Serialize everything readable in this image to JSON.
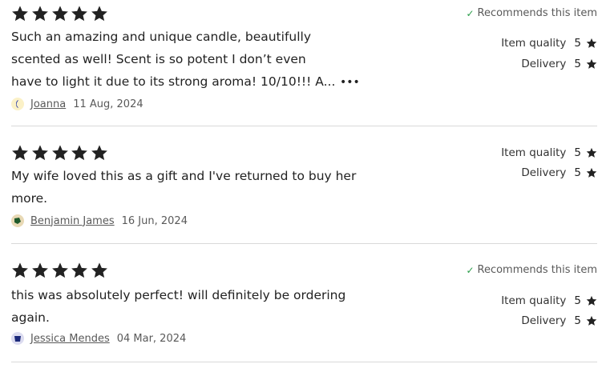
{
  "labels": {
    "recommends": "Recommends this item",
    "item_quality": "Item quality",
    "delivery": "Delivery"
  },
  "reviews": [
    {
      "rating": 5,
      "recommends": true,
      "text_lines": [
        "Such an amazing and unique candle, beautifully",
        "scented as well! Scent is so potent I don’t even",
        "have to light it due to its strong aroma! 10/10!!! A..."
      ],
      "more": "•••",
      "item_quality": "5",
      "delivery": "5",
      "author": "Joanna",
      "date": "11 Aug, 2024"
    },
    {
      "rating": 5,
      "recommends": false,
      "text_lines": [
        "My wife loved this as a gift and I've returned to buy her",
        "more."
      ],
      "item_quality": "5",
      "delivery": "5",
      "author": "Benjamin James",
      "date": "16 Jun, 2024"
    },
    {
      "rating": 5,
      "recommends": true,
      "text_lines": [
        "this was absolutely perfect! will definitely be ordering",
        "again."
      ],
      "item_quality": "5",
      "delivery": "5",
      "author": "Jessica Mendes",
      "date": "04 Mar, 2024"
    }
  ],
  "colors": {
    "star": "#222222",
    "check": "#2a9d4a",
    "muted_text": "#595959",
    "divider": "#d9d9d9"
  }
}
